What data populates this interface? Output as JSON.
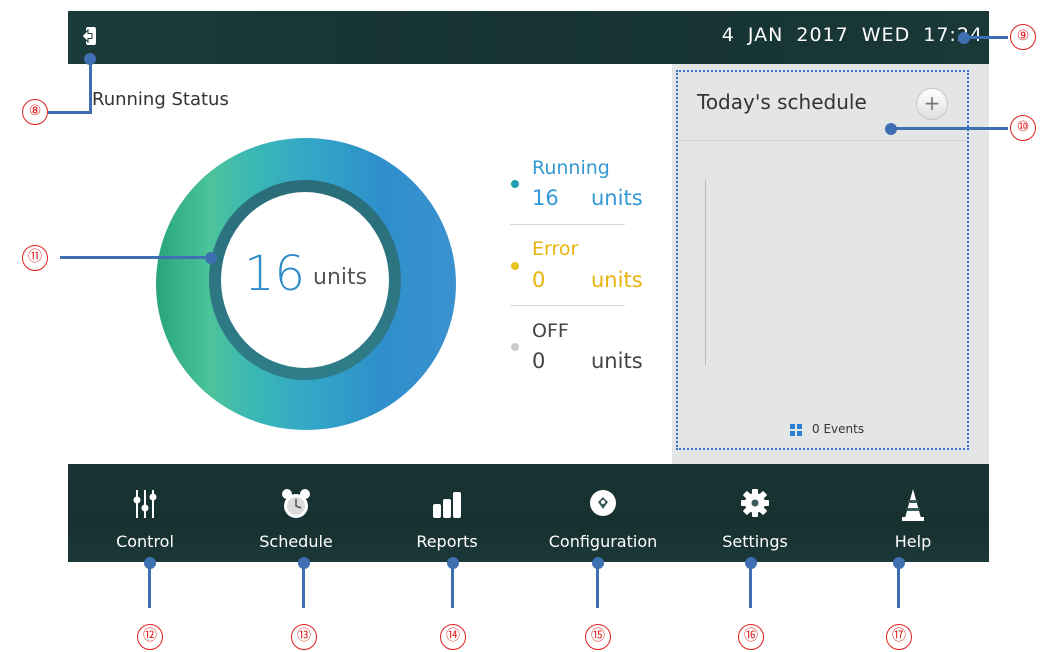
{
  "header": {
    "datetime": "4  JAN  2017  WED  17:24"
  },
  "running_status": {
    "title": "Running Status",
    "center_value": "16",
    "center_unit": "units",
    "legend": [
      {
        "label": "Running",
        "value": "16",
        "units": "units",
        "color": "#3399d4",
        "dot": "#1d9fb0"
      },
      {
        "label": "Error",
        "value": "0",
        "units": "units",
        "color": "#e8b40c",
        "dot": "#e6c320"
      },
      {
        "label": "OFF",
        "value": "0",
        "units": "units",
        "color": "#444444",
        "dot": "#cccccc"
      }
    ]
  },
  "schedule": {
    "title": "Today's schedule",
    "add_icon": "plus-icon",
    "events_label": "0 Events"
  },
  "nav": [
    {
      "label": "Control",
      "icon": "sliders-icon"
    },
    {
      "label": "Schedule",
      "icon": "alarm-clock-icon"
    },
    {
      "label": "Reports",
      "icon": "bar-chart-icon"
    },
    {
      "label": "Configuration",
      "icon": "wrench-circle-icon"
    },
    {
      "label": "Settings",
      "icon": "gear-icon"
    },
    {
      "label": "Help",
      "icon": "cone-icon"
    }
  ],
  "callouts": [
    "⑧",
    "⑨",
    "⑩",
    "⑪",
    "⑫",
    "⑬",
    "⑭",
    "⑮",
    "⑯",
    "⑰"
  ],
  "colors": {
    "bar_bg": "#173232",
    "callout_line": "#3e6fb0",
    "callout_number": "#e02020"
  }
}
